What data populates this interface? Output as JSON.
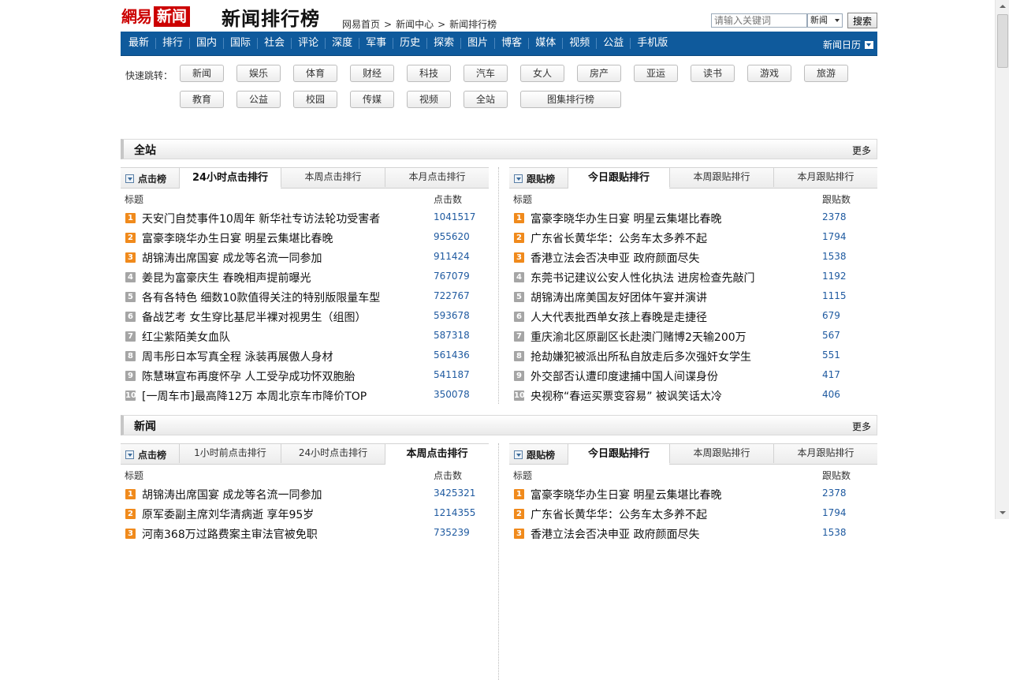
{
  "header": {
    "logo_part1": "網易",
    "logo_part2": "新闻",
    "page_title": "新闻排行榜",
    "breadcrumb": [
      "网易首页",
      "新闻中心",
      "新闻排行榜"
    ],
    "breadcrumb_sep": ">",
    "search_placeholder": "请输入关键词",
    "search_scope": "新闻",
    "search_button": "搜索"
  },
  "nav": {
    "items": [
      "最新",
      "排行",
      "国内",
      "国际",
      "社会",
      "评论",
      "深度",
      "军事",
      "历史",
      "探索",
      "图片",
      "博客",
      "媒体",
      "视频",
      "公益",
      "手机版"
    ],
    "calendar_label": "新闻日历"
  },
  "quick_jump": {
    "label": "快速跳转：",
    "row1": [
      "新闻",
      "娱乐",
      "体育",
      "财经",
      "科技",
      "汽车",
      "女人",
      "房产",
      "亚运",
      "读书",
      "游戏",
      "旅游"
    ],
    "row2": [
      "教育",
      "公益",
      "校园",
      "传媒",
      "视频",
      "全站",
      "图集排行榜"
    ]
  },
  "sections": [
    {
      "title": "全站",
      "more": "更多",
      "left": {
        "label": "点击榜",
        "tabs": [
          "24小时点击排行",
          "本周点击排行",
          "本月点击排行"
        ],
        "active_tab": 0,
        "col_title": "标题",
        "col_value": "点击数",
        "rows": [
          {
            "rank": "1",
            "title": "天安门自焚事件10周年 新华社专访法轮功受害者",
            "value": "1041517"
          },
          {
            "rank": "2",
            "title": "富豪李晓华办生日宴 明星云集堪比春晚",
            "value": "955620"
          },
          {
            "rank": "3",
            "title": "胡锦涛出席国宴 成龙等名流一同参加",
            "value": "911424"
          },
          {
            "rank": "4",
            "title": "姜昆为富豪庆生 春晚相声提前曝光",
            "value": "767079"
          },
          {
            "rank": "5",
            "title": "各有各特色 细数10款值得关注的特别版限量车型",
            "value": "722767"
          },
          {
            "rank": "6",
            "title": "备战艺考 女生穿比基尼半裸对视男生（组图）",
            "value": "593678"
          },
          {
            "rank": "7",
            "title": "红尘紫陌美女血队",
            "value": "587318"
          },
          {
            "rank": "8",
            "title": "周韦彤日本写真全程 泳装再展傲人身材",
            "value": "561436"
          },
          {
            "rank": "9",
            "title": "陈慧琳宣布再度怀孕 人工受孕成功怀双胞胎",
            "value": "541187"
          },
          {
            "rank": "10",
            "title": "[一周车市]最高降12万 本周北京车市降价TOP",
            "value": "350078"
          }
        ]
      },
      "right": {
        "label": "跟贴榜",
        "tabs": [
          "今日跟贴排行",
          "本周跟贴排行",
          "本月跟贴排行"
        ],
        "active_tab": 0,
        "col_title": "标题",
        "col_value": "跟贴数",
        "rows": [
          {
            "rank": "1",
            "title": "富豪李晓华办生日宴 明星云集堪比春晚",
            "value": "2378"
          },
          {
            "rank": "2",
            "title": "广东省长黄华华：公务车太多养不起",
            "value": "1794"
          },
          {
            "rank": "3",
            "title": "香港立法会否决申亚 政府颜面尽失",
            "value": "1538"
          },
          {
            "rank": "4",
            "title": "东莞书记建议公安人性化执法 进房检查先敲门",
            "value": "1192"
          },
          {
            "rank": "5",
            "title": "胡锦涛出席美国友好团体午宴并演讲",
            "value": "1115"
          },
          {
            "rank": "6",
            "title": "人大代表批西单女孩上春晚是走捷径",
            "value": "679"
          },
          {
            "rank": "7",
            "title": "重庆渝北区原副区长赴澳门赌博2天输200万",
            "value": "567"
          },
          {
            "rank": "8",
            "title": "抢劫嫌犯被派出所私自放走后多次强奸女学生",
            "value": "551"
          },
          {
            "rank": "9",
            "title": "外交部否认遭印度逮捕中国人间谍身份",
            "value": "417"
          },
          {
            "rank": "10",
            "title": "央视称“春运买票变容易” 被讽笑话太冷",
            "value": "406"
          }
        ]
      }
    },
    {
      "title": "新闻",
      "more": "更多",
      "left": {
        "label": "点击榜",
        "tabs": [
          "1小时前点击排行",
          "24小时点击排行",
          "本周点击排行"
        ],
        "active_tab": 2,
        "col_title": "标题",
        "col_value": "点击数",
        "rows": [
          {
            "rank": "1",
            "title": "胡锦涛出席国宴 成龙等名流一同参加",
            "value": "3425321"
          },
          {
            "rank": "2",
            "title": "原军委副主席刘华清病逝 享年95岁",
            "value": "1214355"
          },
          {
            "rank": "3",
            "title": "河南368万过路费案主审法官被免职",
            "value": "735239"
          }
        ]
      },
      "right": {
        "label": "跟贴榜",
        "tabs": [
          "今日跟贴排行",
          "本周跟贴排行",
          "本月跟贴排行"
        ],
        "active_tab": 0,
        "col_title": "标题",
        "col_value": "跟贴数",
        "rows": [
          {
            "rank": "1",
            "title": "富豪李晓华办生日宴 明星云集堪比春晚",
            "value": "2378"
          },
          {
            "rank": "2",
            "title": "广东省长黄华华：公务车太多养不起",
            "value": "1794"
          },
          {
            "rank": "3",
            "title": "香港立法会否决申亚 政府颜面尽失",
            "value": "1538"
          }
        ]
      }
    }
  ]
}
